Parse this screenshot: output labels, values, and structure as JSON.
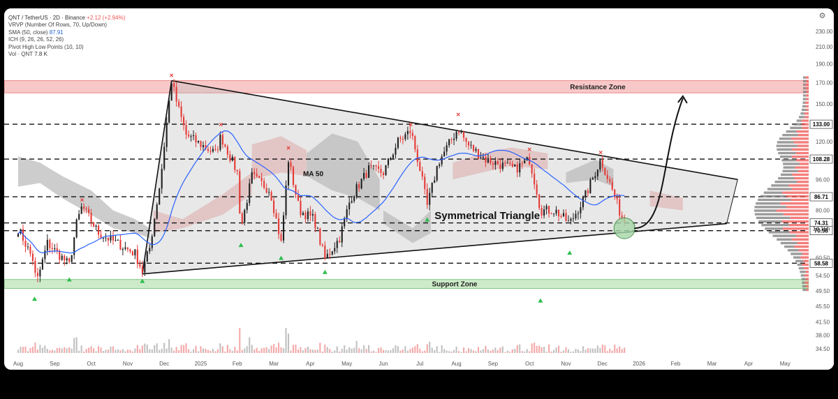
{
  "legend": {
    "symbol": "QNT / TetherUS · 2D · Binance",
    "change": "+2.12 (+2.94%)",
    "vrvp": "VRVP (Number Of Rows, 70, Up/Down)",
    "sma_label": "SMA (50, close)",
    "sma_value": "87.91",
    "ich": "ICH (9, 26, 26, 52, 26)",
    "pivot": "Pivot High Low Points (10, 10)",
    "vol_label": "Vol · QNT",
    "vol_value": "7.8 K"
  },
  "settings_icon": "gear-icon",
  "chart_data": {
    "type": "candlestick",
    "log_scale": true,
    "price_axis_ticks": [
      "230.00",
      "210.00",
      "190.00",
      "170.00",
      "150.00",
      "133.00",
      "120.00",
      "108.28",
      "96.00",
      "86.71",
      "80.00",
      "74.31",
      "70.98",
      "60.50",
      "58.58",
      "54.50",
      "49.50",
      "45.50",
      "41.50",
      "38.00",
      "34.50"
    ],
    "level_labels": [
      {
        "value": 133.0,
        "label": "133.00",
        "color": "#000000"
      },
      {
        "value": 108.28,
        "label": "108.28",
        "color": "#000000"
      },
      {
        "value": 86.71,
        "label": "86.71",
        "color": "#000000"
      },
      {
        "value": 74.31,
        "label": "74.31",
        "color": "#000000"
      },
      {
        "value": 70.98,
        "label": "70.98",
        "color": "#000000"
      },
      {
        "value": 58.58,
        "label": "58.58",
        "color": "#000000"
      }
    ],
    "current_price": "74.31",
    "countdown": "1d 15h",
    "x_labels": [
      "Aug",
      "Sep",
      "Oct",
      "Nov",
      "Dec",
      "2025",
      "Feb",
      "Mar",
      "Apr",
      "May",
      "Jun",
      "Jul",
      "Aug",
      "Sep",
      "Oct",
      "Nov",
      "Dec",
      "2026",
      "Feb",
      "Mar",
      "Apr",
      "May"
    ],
    "bars_per_month": 15,
    "dashed_levels": [
      133.0,
      108.28,
      86.71,
      74.31,
      70.98,
      58.58
    ],
    "resistance_zone": {
      "label": "Resistance Zone",
      "low": 160,
      "high": 172
    },
    "support_zone": {
      "label": "Support Zone",
      "low": 50.5,
      "high": 53.2
    },
    "triangle_label": "Symmetrical Triangle",
    "ma_label": "MA 50",
    "triangle": {
      "apex_top": {
        "bar": 0,
        "price": 172
      },
      "start": {
        "bar": 0,
        "price": 55
      },
      "top_end": {
        "bar": 0,
        "price": 96
      },
      "bottom_end": {
        "bar": 0,
        "price": 74
      }
    },
    "pivot_highs": [
      {
        "month": 1.75,
        "price": 84
      },
      {
        "month": 4.2,
        "price": 175
      },
      {
        "month": 5.55,
        "price": 131
      },
      {
        "month": 7.4,
        "price": 114
      },
      {
        "month": 10.75,
        "price": 131
      },
      {
        "month": 12.05,
        "price": 139
      },
      {
        "month": 14.0,
        "price": 113
      },
      {
        "month": 15.95,
        "price": 111
      }
    ],
    "pivot_lows": [
      {
        "month": 0.45,
        "price": 49.5
      },
      {
        "month": 1.4,
        "price": 55.5
      },
      {
        "month": 3.4,
        "price": 55
      },
      {
        "month": 6.1,
        "price": 68
      },
      {
        "month": 7.2,
        "price": 63
      },
      {
        "month": 8.4,
        "price": 58
      },
      {
        "month": 11.2,
        "price": 79
      },
      {
        "month": 14.3,
        "price": 49
      },
      {
        "month": 15.1,
        "price": 65
      }
    ],
    "colors": {
      "up": "#26a69a",
      "down": "#ef5350",
      "candle_up": "#1f1f1f",
      "candle_down": "#e53935",
      "ma": "#2962ff",
      "resistance": "#f8c8c8",
      "support": "#cdebc8",
      "cloud_red": "#f5c2c2",
      "cloud_gray": "#c4c4c4"
    }
  }
}
